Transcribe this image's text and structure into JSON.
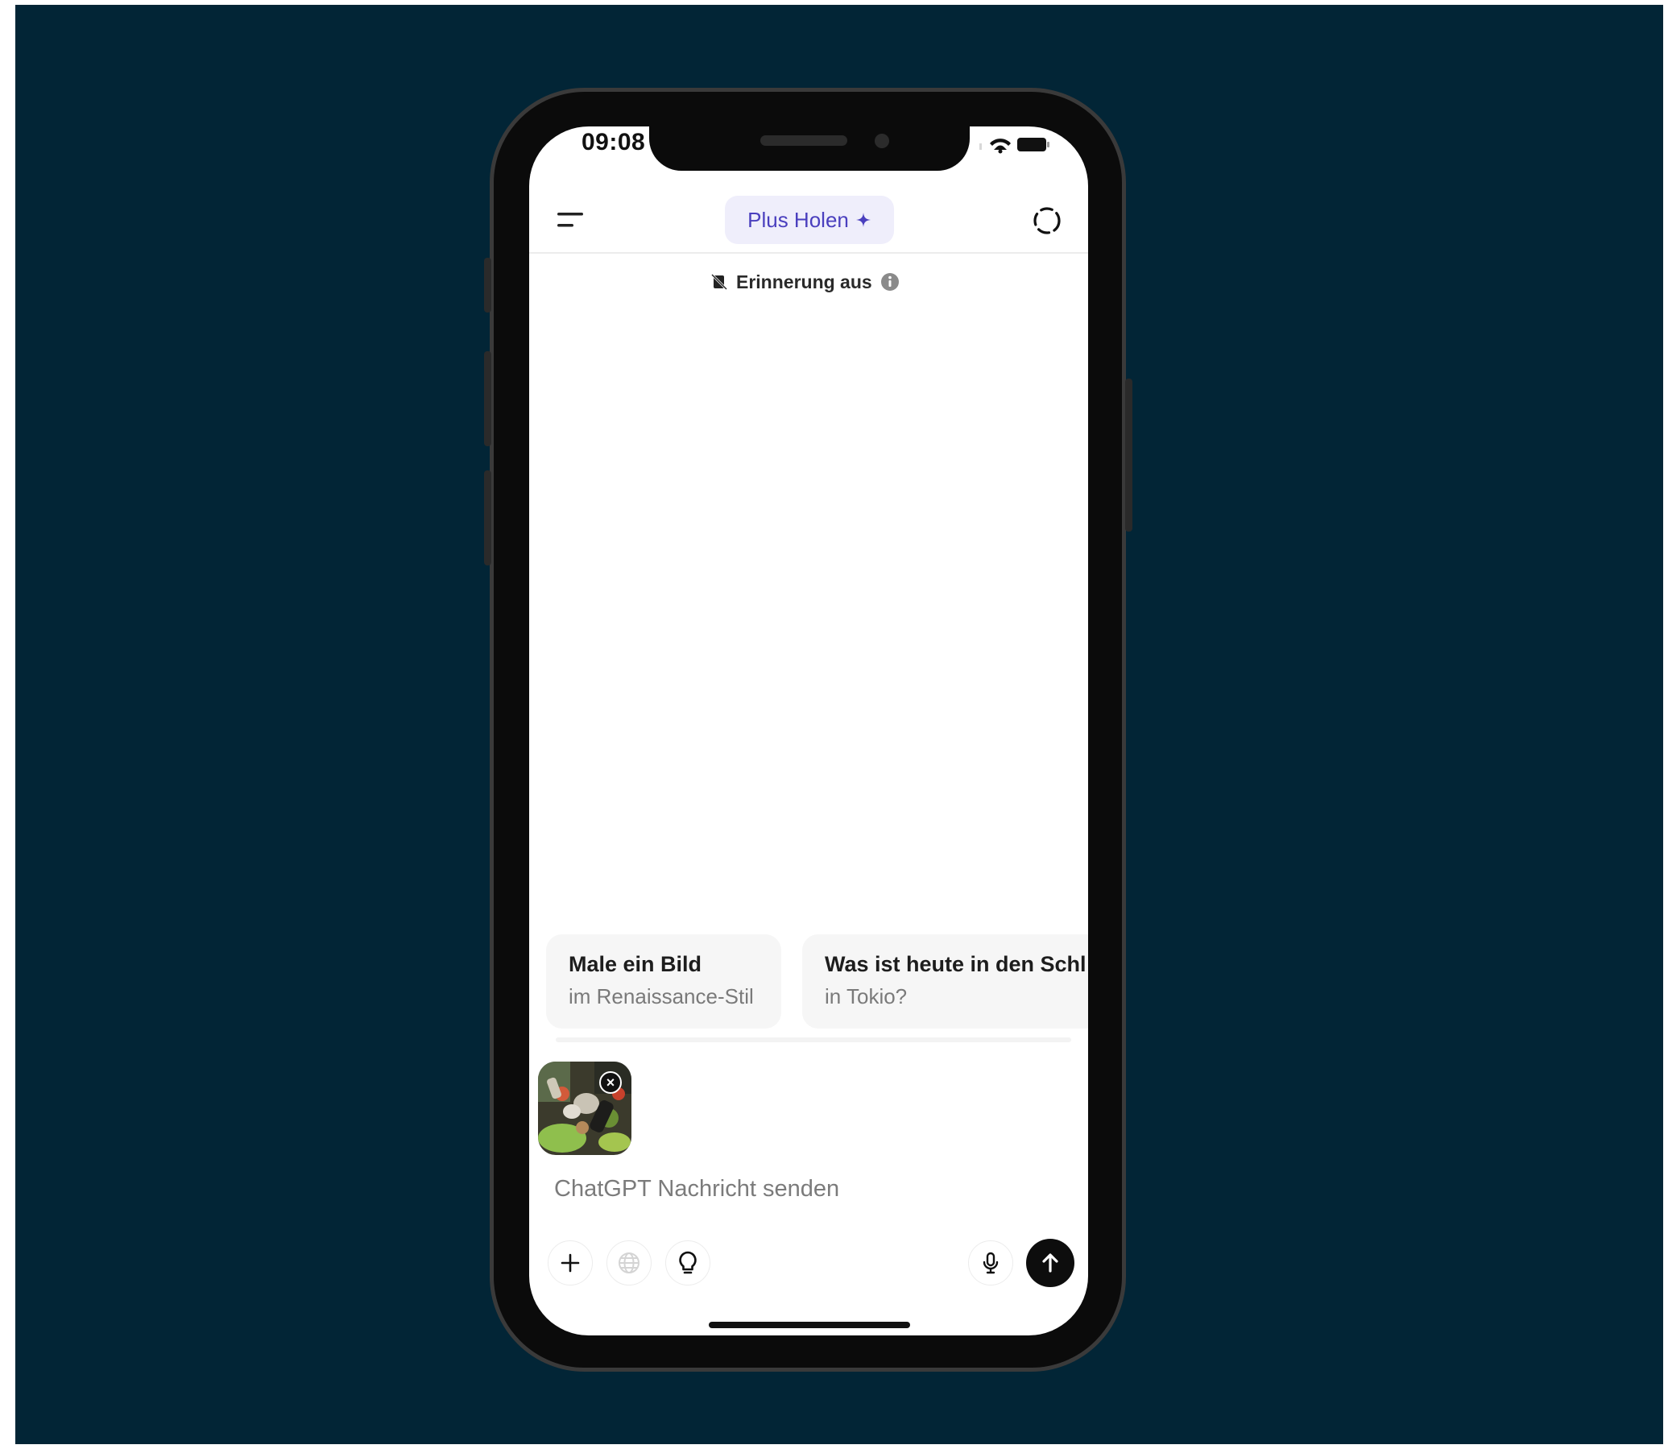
{
  "status_bar": {
    "time": "09:08"
  },
  "header": {
    "upgrade_label": "Plus Holen",
    "upgrade_icon": "sparkle-plus-icon",
    "accent_color": "#4a3fbe",
    "pill_bg": "#efeefb"
  },
  "memory": {
    "label": "Erinnerung aus"
  },
  "suggestions": [
    {
      "title": "Male ein Bild",
      "subtitle": "im Renaissance-Stil"
    },
    {
      "title": "Was ist heute in den Schl",
      "subtitle": "in Tokio?"
    }
  ],
  "composer": {
    "placeholder": "ChatGPT Nachricht senden",
    "value": "",
    "attachment_close": "×"
  },
  "toolbar": {
    "icons": [
      "plus-icon",
      "globe-icon",
      "lightbulb-icon",
      "microphone-icon",
      "arrow-up-icon"
    ]
  },
  "colors": {
    "background": "#022536",
    "send_button": "#0d0d0d"
  }
}
